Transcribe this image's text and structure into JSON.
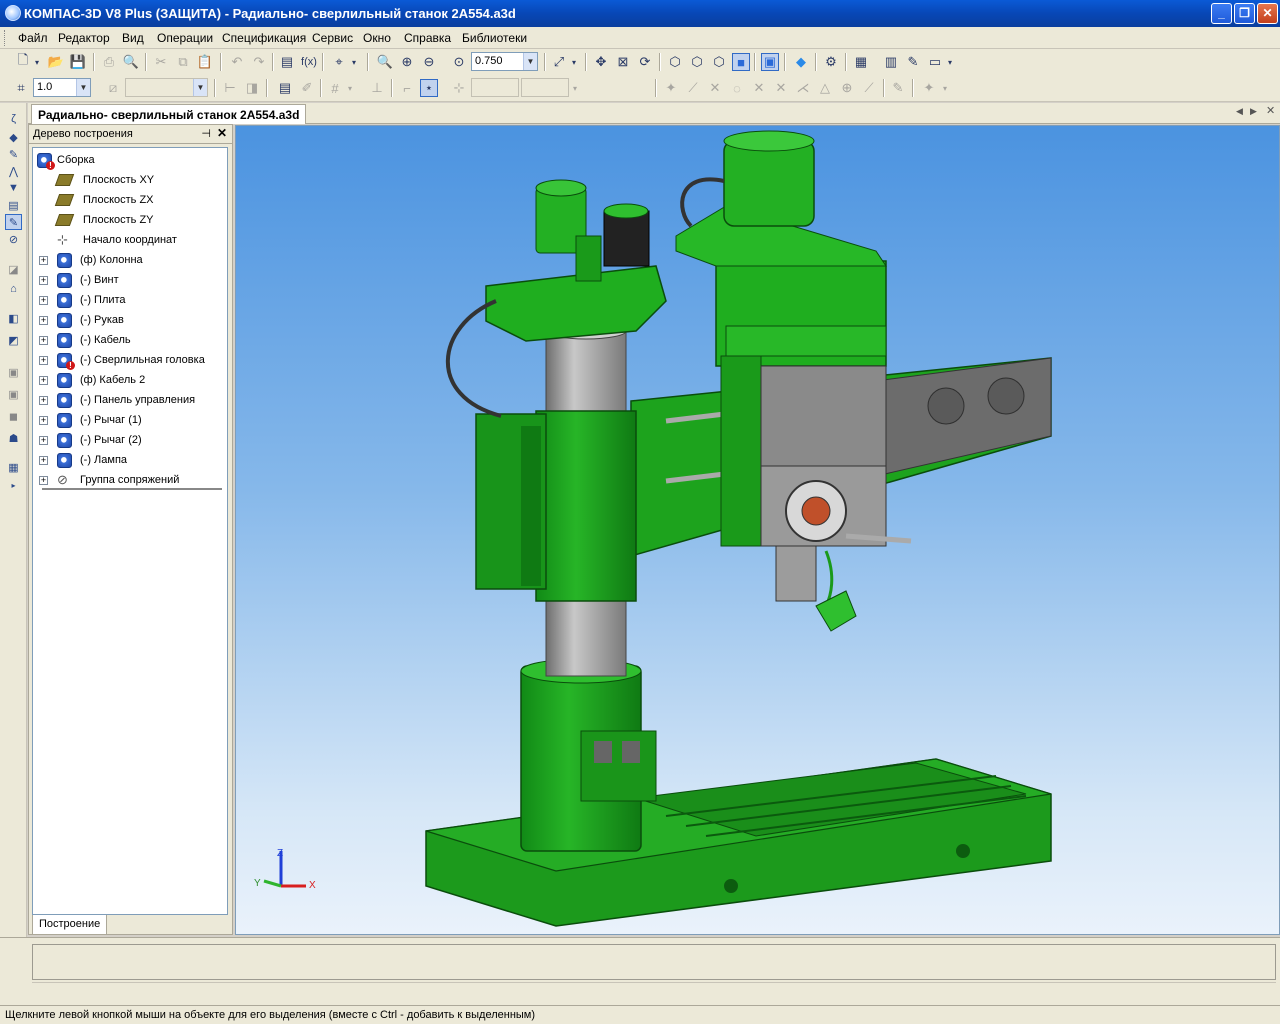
{
  "window": {
    "title": "КОМПАС-3D V8 Plus (ЗАЩИТА) - Радиально- сверлильный станок 2А554.a3d",
    "minimize": "_",
    "restore": "❐",
    "close": "✕"
  },
  "menu": [
    "Файл",
    "Редактор",
    "Вид",
    "Операции",
    "Спецификация",
    "Сервис",
    "Окно",
    "Справка",
    "Библиотеки"
  ],
  "toolbar": {
    "zoom_value": "0.750",
    "step_value": "1.0"
  },
  "document_tab": "Радиально- сверлильный станок 2А554.a3d",
  "tree": {
    "header": "Дерево построения",
    "root": "Сборка",
    "planes": [
      "Плоскость XY",
      "Плоскость ZX",
      "Плоскость ZY"
    ],
    "origin": "Начало координат",
    "components": [
      {
        "label": "(ф) Колонна",
        "error": false
      },
      {
        "label": "(-) Винт",
        "error": false
      },
      {
        "label": "(-) Плита",
        "error": false
      },
      {
        "label": "(-) Рукав",
        "error": false
      },
      {
        "label": "(-) Кабель",
        "error": false
      },
      {
        "label": "(-) Сверлильная головка",
        "error": true
      },
      {
        "label": "(ф) Кабель 2",
        "error": false
      },
      {
        "label": "(-) Панель управления",
        "error": false
      },
      {
        "label": "(-) Рычаг (1)",
        "error": false
      },
      {
        "label": "(-) Рычаг (2)",
        "error": false
      },
      {
        "label": "(-) Лампа",
        "error": false
      }
    ],
    "mates": "Группа сопряжений",
    "tab": "Построение"
  },
  "axes": {
    "x": "X",
    "y": "Y",
    "z": "Z"
  },
  "colors": {
    "machine_green": "#1fa31f",
    "machine_dark": "#0d6e12",
    "column_gray": "#9a9a9a",
    "panel_gray": "#8c8c8c"
  },
  "status": "Щелкните левой кнопкой мыши на объекте для его выделения (вместе с Ctrl - добавить к выделенным)"
}
